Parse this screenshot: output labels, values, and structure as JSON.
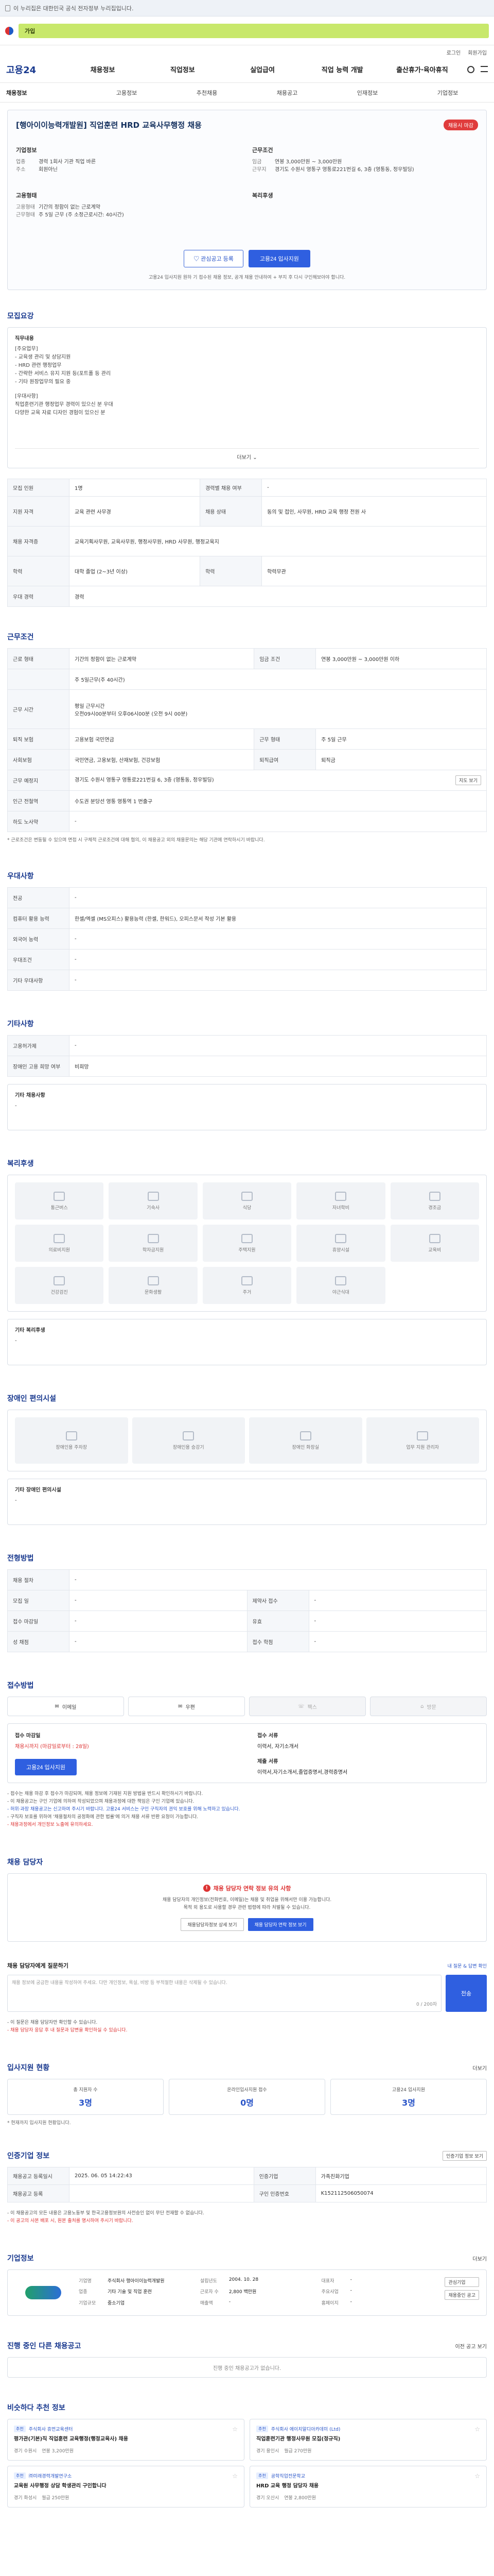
{
  "notice": {
    "text": "이 누리집은 대한민국 공식 전자정부 누리집입니다."
  },
  "banner": {
    "text": "가입"
  },
  "utility": {
    "links": [
      "로그인",
      "회원가입"
    ]
  },
  "nav": {
    "brand": "고용24",
    "items": [
      "채용정보",
      "직업정보",
      "실업급여",
      "직업 능력 개발",
      "출산휴가·육아휴직"
    ]
  },
  "subnav": {
    "items": [
      "채용정보",
      "고용정보",
      "추천채용",
      "채용공고",
      "인재정보",
      "기업정보"
    ]
  },
  "job": {
    "title": "[행아이이능력개발원] 직업훈련 HRD 교육사무행정 채용",
    "status": "채용시 마감",
    "company_header": "기업정보",
    "company_rows": [
      {
        "k": "업종",
        "v": "경력 1회사 기관 직업 바른"
      },
      {
        "k": "주소",
        "v": "회원아닌"
      }
    ],
    "cond_header": "근무조건",
    "cond_rows": [
      {
        "k": "임금",
        "v": "연봉 3,000만원 ~ 3,000만원"
      },
      {
        "k": "근무지",
        "v": "경기도 수원시 영통구 영통로221번길 6, 3층 (영통동, 정우빌딩)"
      }
    ],
    "req_header": "고용형태",
    "req_rows": [
      {
        "k": "고용형태",
        "v": "기간의 정함이 없는 근로계약"
      },
      {
        "k": "근무형태",
        "v": "주 5일 근무 (주 소정근로시간: 40시간)"
      }
    ],
    "welfare_header": "복리후생",
    "save_button": "관심공고 등록",
    "apply_button": "고용24 입사지원",
    "note": "고용24 입사지원 원하 기 접수된 채용 정보, 공개 채용 안내하여 + 부지 후 다시 구인해보아야 합니다."
  },
  "summary": {
    "title": "모집요강",
    "desc_title": "직무내용",
    "desc_lines": [
      "[주요업무]",
      "- 교육생 관리 및 상담지원",
      "- HRD 관련 행정업무",
      "- 간략한 서비스 유지 지원 등(포트폴 등 관리",
      "- 기타 원장업무의 필요 중",
      "",
      "[우대사항]",
      "직업훈련기관 행정업무 경력이 있으신 분 우대",
      "다양한 교육 자료 디자인 경험이 있으신 분"
    ],
    "more": "더보기",
    "rows": [
      {
        "k": "모집 인원",
        "v": "1명",
        "k2": "경력별 채용 여부",
        "v2": "-"
      },
      {
        "k": "지원 자격",
        "v": "교육 관련 사무경",
        "k2": "채용 상태",
        "v2": "동의 및 접인, 사무원, HRD 교육 행정 전원 사"
      },
      {
        "k": "채용 자격증",
        "v": "교육기획사무원, 교육사무원, 행정사무원, HRD 사무원, 행정교육지",
        "k2": "",
        "v2": ""
      },
      {
        "k": "학력",
        "v": "대학 졸업 (2~3년 이상)",
        "k2": "학력",
        "v2": "학력무관"
      },
      {
        "k": "우대 경력",
        "v": "경력",
        "k2": "",
        "v2": ""
      }
    ]
  },
  "workcond": {
    "title": "근무조건",
    "rows": [
      {
        "k": "근로 형태",
        "v": "기간의 정함이 없는 근로계약",
        "k2": "임금 조건",
        "v2": "연봉 3,000만원 ~ 3,000만원 이하"
      },
      {
        "k": "",
        "v": "주 5일근무(주 40시간)",
        "k2": "",
        "v2": ""
      },
      {
        "k": "근무 시간",
        "v": "평일 근무시간\n오전09시00분부터 오후06시00분 (오전 9시 00분)",
        "k2": "",
        "v2": ""
      },
      {
        "k": "퇴직 보험",
        "v": "고용보험 국민연금",
        "k2": "근무 형태",
        "v2": "주 5일 근무"
      },
      {
        "k": "사회보험",
        "v": "국민연금, 고용보험, 산재보험, 건강보험",
        "k2": "퇴직급여",
        "v2": "퇴직금"
      },
      {
        "k": "근무 예정지",
        "v": "경기도 수원시 영통구 영통로221번길 6, 3층 (영통동, 정우빌딩)",
        "k2": "",
        "v2": ""
      },
      {
        "k": "인근 전철역",
        "v": "수도권 분당선 영통 영통역 1 번출구",
        "k2": "",
        "v2": ""
      },
      {
        "k": "하도 노사약",
        "v": "-",
        "k2": "",
        "v2": ""
      }
    ],
    "map_button": "지도 보기",
    "note": "* 근로조건은 변동될 수 있으며 면접 시 구체적 근로조건에 대해 협의, 이 채용공고 외의 채용문의는 해당 기관에 연락하시기 바랍니다."
  },
  "prefer": {
    "title": "우대사항",
    "rows": [
      {
        "k": "전공",
        "v": "-"
      },
      {
        "k": "컴퓨터 활용 능력",
        "v": "한셀/엑셀 (MS오피스) 활용능력 (한셀, 한워드), 오피스문서 작성 기본 활용"
      },
      {
        "k": "외국어 능력",
        "v": "-"
      },
      {
        "k": "우대조건",
        "v": "-"
      },
      {
        "k": "기타 우대사항",
        "v": "-"
      }
    ]
  },
  "etc": {
    "title": "기타사항",
    "rows": [
      {
        "k": "고용허가제",
        "v": "-"
      },
      {
        "k": "장애인 고용 희망 여부",
        "v": "비희망"
      }
    ],
    "extra_label": "기타 채용사항",
    "extra_value": "-"
  },
  "welfare": {
    "title": "복리후생",
    "tiles": [
      "통근버스",
      "기숙사",
      "식당",
      "자녀학비",
      "경조금",
      "의료비지원",
      "학자금지원",
      "주택지원",
      "휴양시설",
      "교육비",
      "건강검진",
      "문화생활",
      "주거",
      "야근식대"
    ],
    "extra_label": "기타 복리후생",
    "extra_value": "-"
  },
  "disability": {
    "title": "장애인 편의시설",
    "tiles": [
      "장애인용 주차장",
      "장애인용 승강기",
      "장애인 화장실",
      "업무 지원 관리자"
    ],
    "extra_label": "기타 장애인 편의시설",
    "extra_value": "-"
  },
  "apply": {
    "title": "전형방법",
    "rows": [
      {
        "k": "채용 절차",
        "v": "-",
        "k2": "",
        "v2": ""
      },
      {
        "k": "모집 일",
        "v": "-",
        "k2": "제약사 접수",
        "v2": "-"
      },
      {
        "k": "접수 마감일",
        "v": "-",
        "k2": "유효",
        "v2": "-"
      },
      {
        "k": "성 채점",
        "v": "-",
        "k2": "접수 학점",
        "v2": "-"
      }
    ]
  },
  "method": {
    "title": "접수방법",
    "tiles": [
      {
        "label": "이메일",
        "on": true
      },
      {
        "label": "우편",
        "on": true
      },
      {
        "label": "팩스",
        "on": false
      },
      {
        "label": "방문",
        "on": false
      }
    ],
    "deadline_label": "접수 마감일",
    "deadline_value": "채용시까지 (마감일로부터 : 28일)",
    "apply_button": "고용24 입사지원",
    "docs_label": "접수 서류",
    "docs_value": "이력서, 자기소개서",
    "docs_label2": "제출 서류",
    "docs_value2": "이력서,자기소개서,졸업증명서,경력증명서",
    "bullets": [
      "- 접수는 채용 마감 후 접수가 마감되며, 채용 정보에 기재된 지원 방법을 반드시 확인하시기 바랍니다.",
      "- 이 채용공고는 구인 기업에 의하여 작성되었으며 채용과정에 대한 책임은 구인 기업에 있습니다.",
      "- 허위·과장 채용공고는 신고하여 주시기 바랍니다. 고용24 서비스는 구인 구직자의 권익 보호를 위해 노력하고 있습니다.",
      "- 구직자 보호를 위하여 '채용절차의 공정화에 관한 법률'에 의거 채용 서류 반환 요청이 가능합니다.",
      "- 채용과정에서 개인정보 노출에 유의하세요."
    ]
  },
  "contact": {
    "title": "채용 담당자",
    "warn_title": "채용 담당자 연락 정보 유의 사항",
    "warn_text": "채용 담당자의 개인정보(전화번호, 이메일)는 채용 및 취업을 위해서만 이용 가능합니다.\n목적 외 용도로 사용할 경우 관련 법령에 따라 처벌될 수 있습니다.",
    "btn_view": "채용담당자정보 상세 보기",
    "btn_apply": "채용 담당자 연락 정보 보기"
  },
  "qa": {
    "title": "채용 담당자에게 질문하기",
    "note": "내 질문 & 답변 확인",
    "placeholder": "채용 정보에 궁금한 내용을 작성하여 주세요. 다만 개인정보, 욕설, 비방 등 부적절한 내용은 삭제될 수 있습니다.",
    "count": "0 / 200자",
    "submit": "전송",
    "bullets": [
      "- 이 질문은 채용 담당자만 확인할 수 있습니다.",
      "- 채용 담당자 응답 후 내 질문과 답변을 확인하실 수 있습니다."
    ]
  },
  "stats": {
    "title": "입사지원 현황",
    "more": "더보기",
    "cards": [
      {
        "label": "총 지원자 수",
        "value": "3명"
      },
      {
        "label": "온라인입사지원 접수",
        "value": "0명"
      },
      {
        "label": "고용24 입사지원",
        "value": "3명"
      }
    ],
    "note": "* 현재까지 입사지원 현황입니다."
  },
  "meta": {
    "title": "인증기업 정보",
    "button": "인증기업 정보 보기",
    "rows": [
      {
        "k": "채용공고 등록일시",
        "v": "2025. 06. 05 14:22:43",
        "k2": "인증기업",
        "v2": "가족친화기업"
      },
      {
        "k": "채용공고 등록",
        "v": "",
        "k2": "구인 인증번호",
        "v2": "K152112506050074"
      }
    ],
    "bullets": [
      "- 이 채용공고의 모든 내용은 고용노동부 및 한국고용정보원의 사전승인 없이 무단 전재할 수 없습니다.",
      "- 이 공고의 사본 배포 시, 원본 출처를 명시하여 주시기 바랍니다."
    ]
  },
  "company": {
    "title": "기업정보",
    "more": "더보기",
    "rows": [
      {
        "k": "기업명",
        "v": "주식회사 행아이이능력개발원"
      },
      {
        "k": "설립년도",
        "v": "2004. 10. 28"
      },
      {
        "k": "대표자",
        "v": "-"
      },
      {
        "k": "업종",
        "v": "기타 기술 및 직업 훈련"
      },
      {
        "k": "근로자 수",
        "v": "2,800 백만원"
      },
      {
        "k": "주요사업",
        "v": "-"
      },
      {
        "k": "기업규모",
        "v": "중소기업"
      },
      {
        "k": "매출액",
        "v": "-"
      },
      {
        "k": "홈페이지",
        "v": "-"
      }
    ],
    "btn_follow": "관심기업",
    "btn_other": "채용중인 공고"
  },
  "other_jobs": {
    "title": "진행 중인 다른 채용공고",
    "more": "이전 공고 보기",
    "empty": "진행 중인 채용공고가 없습니다."
  },
  "recommend": {
    "title": "비슷하다 추천 정보",
    "cards": [
      {
        "co": "주식회사 휴먼교육센터",
        "tag": "추천",
        "title": "평가관(기본)직 직업훈련 교육행정(행정교육사) 채용",
        "loc": "경기 수원시",
        "pay": "연봉 3,200만원"
      },
      {
        "co": "주식회사 에이치알디아카데미 (Ltd)",
        "tag": "추천",
        "title": "직업훈련기관 행정사무원 모집(정규직)",
        "loc": "경기 용인시",
        "pay": "월급 270만원"
      },
      {
        "co": "㈜미래경력개발연구소",
        "tag": "추천",
        "title": "교육원 사무행정 상담 학생관리 구인합니다",
        "loc": "경기 화성시",
        "pay": "월급 250만원"
      },
      {
        "co": "공학직업전문학교",
        "tag": "추천",
        "title": "HRD 교육 행정 담당자 채용",
        "loc": "경기 오산시",
        "pay": "연봉 2,800만원"
      }
    ]
  }
}
